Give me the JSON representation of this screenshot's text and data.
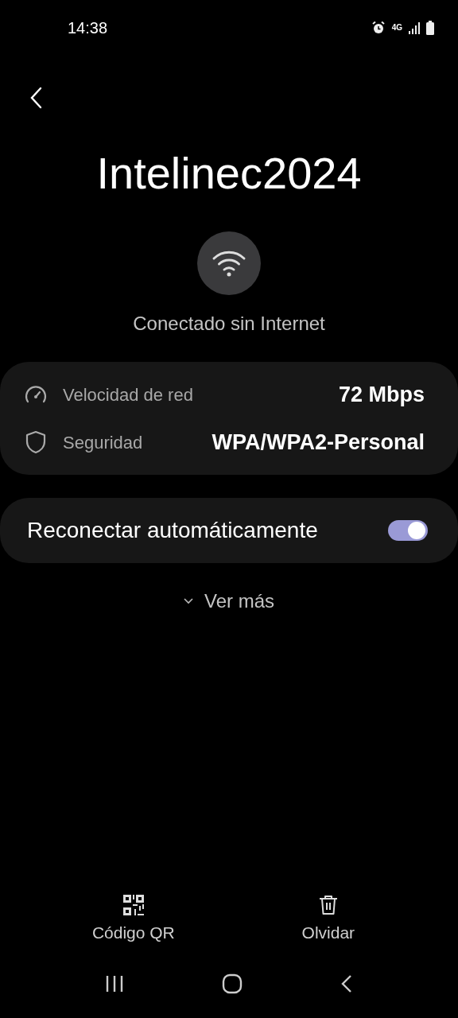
{
  "status_bar": {
    "time": "14:38",
    "network": "4G"
  },
  "title": "Intelinec2024",
  "connection_status": "Conectado sin Internet",
  "details": [
    {
      "kind": "speed",
      "label": "Velocidad de red",
      "value": "72 Mbps"
    },
    {
      "kind": "security",
      "label": "Seguridad",
      "value": "WPA/WPA2-Personal"
    }
  ],
  "auto_reconnect": {
    "label": "Reconectar automáticamente",
    "on": true
  },
  "see_more": "Ver más",
  "actions": [
    {
      "kind": "qr",
      "label": "Código QR"
    },
    {
      "kind": "delete",
      "label": "Olvidar"
    }
  ]
}
